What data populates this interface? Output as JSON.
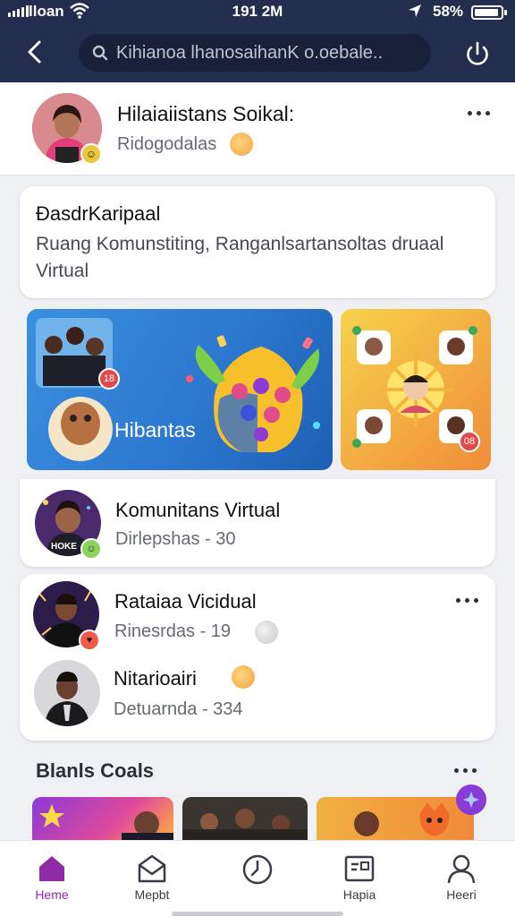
{
  "status_bar": {
    "carrier": "lloan",
    "time": "191 2M",
    "battery": "58%"
  },
  "header": {
    "search_placeholder": "Kihianoa lhanosaihanK o.oebale.."
  },
  "profile": {
    "name": "Hilaiaiistans Soikal:",
    "subtitle": "Ridogodalas"
  },
  "description": {
    "title": "ÐasdrKaripaal",
    "text": "Ruang Komunstiting, Ranganlsartansoltas druaal Virtual"
  },
  "banners": [
    {
      "label": "Hibantas"
    },
    {
      "count": "08"
    }
  ],
  "banner_badge": "18",
  "groups": [
    {
      "name": "Komunitans Virtual",
      "meta": "Dirlepshas - 30"
    },
    {
      "name": "Rataiaa Vicidual",
      "meta": "Rinesrdas - 19"
    },
    {
      "name": "Nitarioairi",
      "meta": "Detuarnda - 334"
    }
  ],
  "section": {
    "title": "Blanls Coals"
  },
  "bottom_nav": [
    {
      "label": "Heme"
    },
    {
      "label": "Mepbt"
    },
    {
      "label": ""
    },
    {
      "label": "Hapia"
    },
    {
      "label": "Heeri"
    }
  ],
  "colors": {
    "header": "#232d4e",
    "accent": "#8e2aa6",
    "banner_blue": "#2d7fd6",
    "banner_orange": "#f2a93a"
  }
}
